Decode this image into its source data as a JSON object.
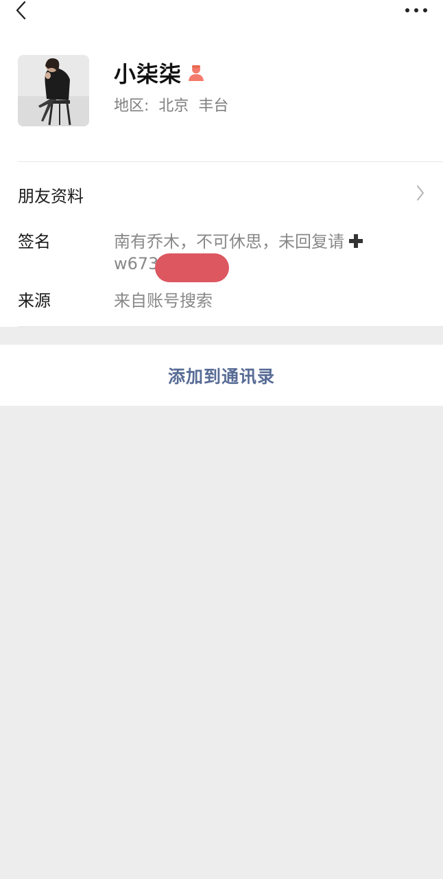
{
  "header": {
    "back_icon": "chevron-left-icon",
    "more_icon": "more-dots-icon"
  },
  "profile": {
    "avatar": "profile-photo",
    "name": "小柒柒",
    "gender_icon": "female-icon",
    "gender_color": "#f37b6b",
    "region": "地区:  北京  丰台"
  },
  "rows": {
    "friend_info_label": "朋友资料",
    "signature_label": "签名",
    "signature_line1": "南有乔木，不可休思，未回复请",
    "signature_line2": "w673",
    "source_label": "来源",
    "source_value": "来自账号搜索"
  },
  "action": {
    "add_contact_label": "添加到通讯录",
    "accent": "#576b95"
  }
}
